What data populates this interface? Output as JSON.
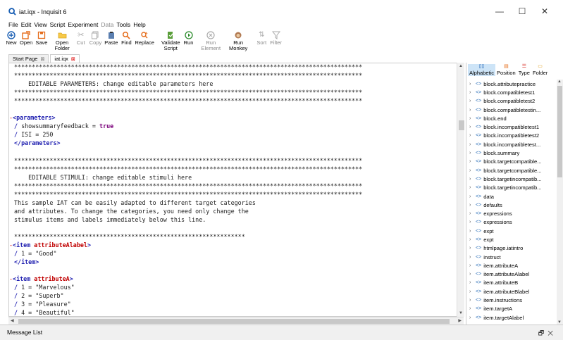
{
  "window": {
    "title": "iat.iqx - Inquisit 6"
  },
  "menu": [
    "File",
    "Edit",
    "View",
    "Script",
    "Experiment",
    "Data",
    "Tools",
    "Help"
  ],
  "toolbar": [
    {
      "label": "New",
      "icon": "new-icon",
      "enabled": true
    },
    {
      "label": "Open",
      "icon": "open-icon",
      "enabled": true
    },
    {
      "label": "Save",
      "icon": "save-icon",
      "enabled": true
    },
    {
      "label": "Open\nFolder",
      "icon": "folder-icon",
      "enabled": true
    },
    {
      "label": "Cut",
      "icon": "cut-icon",
      "enabled": false
    },
    {
      "label": "Copy",
      "icon": "copy-icon",
      "enabled": false
    },
    {
      "label": "Paste",
      "icon": "paste-icon",
      "enabled": true
    },
    {
      "label": "Find",
      "icon": "find-icon",
      "enabled": true
    },
    {
      "label": "Replace",
      "icon": "replace-icon",
      "enabled": true
    },
    {
      "label": "Validate\nScript",
      "icon": "validate-icon",
      "enabled": true
    },
    {
      "label": "Run",
      "icon": "run-icon",
      "enabled": true
    },
    {
      "label": "Run\nElement",
      "icon": "run-element-icon",
      "enabled": false
    },
    {
      "label": "Run\nMonkey",
      "icon": "run-monkey-icon",
      "enabled": true
    },
    {
      "label": "Sort",
      "icon": "sort-icon",
      "enabled": false
    },
    {
      "label": "Filter",
      "icon": "filter-icon",
      "enabled": false
    }
  ],
  "tabs": [
    {
      "label": "Start Page",
      "active": false
    },
    {
      "label": "iat.iqx",
      "active": true
    }
  ],
  "code_lines": [
    "**************************************************************************************************",
    "**************************************************************************************************",
    "    EDITABLE PARAMETERS: change editable parameters here",
    "**************************************************************************************************",
    "**************************************************************************************************",
    "",
    "<parameters>",
    "/ showsummaryfeedback = true",
    "/ ISI = 250",
    "</parameters>",
    "",
    "**************************************************************************************************",
    "**************************************************************************************************",
    "    EDITABLE STIMULI: change editable stimuli here",
    "**************************************************************************************************",
    "**************************************************************************************************",
    "This sample IAT can be easily adapted to different target categories",
    "and attributes. To change the categories, you need only change the",
    "stimulus items and labels immediately below this line.",
    "",
    "*****************************************************************",
    "<item attributeAlabel>",
    "/ 1 = \"Good\"",
    "</item>",
    "",
    "<item attributeA>",
    "/ 1 = \"Marvelous\"",
    "/ 2 = \"Superb\"",
    "/ 3 = \"Pleasure\"",
    "/ 4 = \"Beautiful\""
  ],
  "sidebar": {
    "tabs": [
      {
        "label": "Alphabetic",
        "active": true
      },
      {
        "label": "Position",
        "active": false
      },
      {
        "label": "Type",
        "active": false
      },
      {
        "label": "Folder",
        "active": false
      }
    ],
    "items": [
      "block.attributepractice",
      "block.compatibletest1",
      "block.compatibletest2",
      "block.compatibletestin...",
      "block.end",
      "block.incompatibletest1",
      "block.incompatibletest2",
      "block.incompatibletest...",
      "block.summary",
      "block.targetcompatible...",
      "block.targetcompatible...",
      "block.targetincompatib...",
      "block.targetincompatib...",
      "data",
      "defaults",
      "expressions",
      "expressions",
      "expt",
      "expt",
      "htmlpage.iatintro",
      "instruct",
      "item.attributeA",
      "item.attributeAlabel",
      "item.attributeB",
      "item.attributeBlabel",
      "item.instructions",
      "item.targetA",
      "item.targetAlabel"
    ]
  },
  "message_panel": {
    "title": "Message List"
  }
}
